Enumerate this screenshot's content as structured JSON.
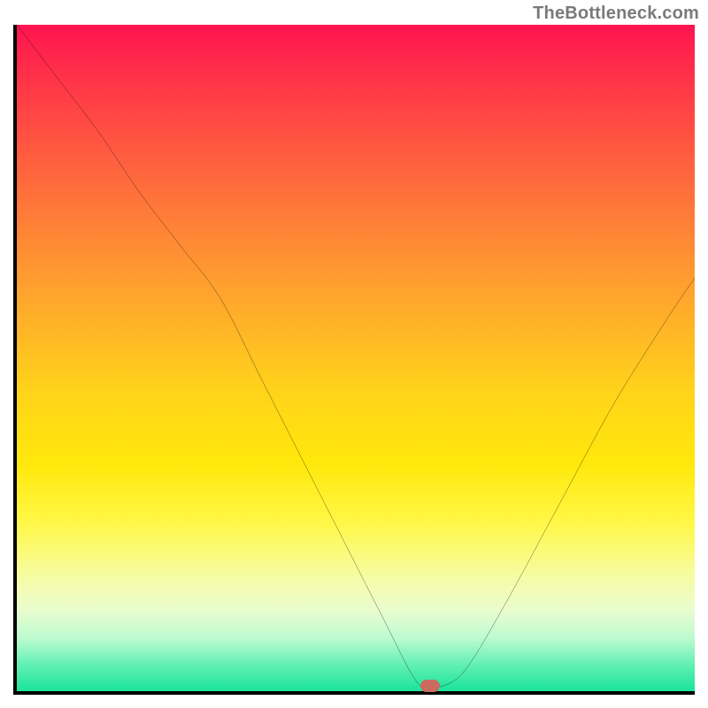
{
  "watermark": {
    "text": "TheBottleneck.com"
  },
  "chart_data": {
    "type": "line",
    "title": "",
    "xlabel": "",
    "ylabel": "",
    "xlim": [
      0,
      100
    ],
    "ylim": [
      0,
      100
    ],
    "grid": false,
    "series": [
      {
        "name": "curve",
        "color": "#000000",
        "x": [
          0,
          6,
          12,
          18,
          24,
          30,
          36,
          42,
          48,
          54,
          58,
          60,
          62,
          66,
          72,
          80,
          88,
          96,
          100
        ],
        "values": [
          100,
          92,
          84,
          75,
          67,
          59,
          47,
          35,
          23,
          11,
          3,
          0.5,
          0.5,
          3,
          13,
          28,
          43,
          56,
          62
        ]
      }
    ],
    "annotations": [
      {
        "name": "min-marker",
        "x": 61,
        "y": 0.8,
        "color": "#cb6a5f"
      }
    ],
    "background_gradient_stops": [
      {
        "pos": 0,
        "color": "#ff1450"
      },
      {
        "pos": 10,
        "color": "#ff3a47"
      },
      {
        "pos": 24,
        "color": "#ff6c3c"
      },
      {
        "pos": 40,
        "color": "#ffa32e"
      },
      {
        "pos": 55,
        "color": "#ffd31a"
      },
      {
        "pos": 66,
        "color": "#ffe80b"
      },
      {
        "pos": 75,
        "color": "#fff84a"
      },
      {
        "pos": 83,
        "color": "#f6fca6"
      },
      {
        "pos": 88,
        "color": "#e8fccf"
      },
      {
        "pos": 92,
        "color": "#bdfbd0"
      },
      {
        "pos": 96,
        "color": "#63f0b4"
      },
      {
        "pos": 100,
        "color": "#19e39b"
      }
    ]
  }
}
